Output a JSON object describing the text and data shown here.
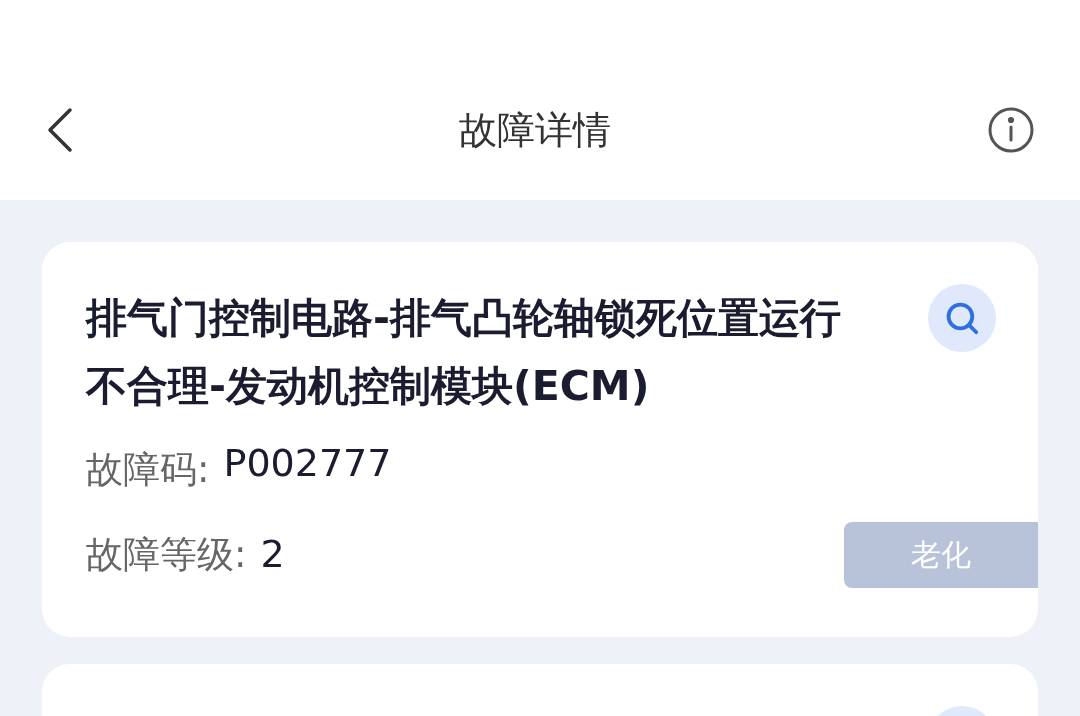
{
  "header": {
    "title": "故障详情"
  },
  "card": {
    "title": "排气门控制电路-排气凸轮轴锁死位置运行不合理-发动机控制模块(ECM)",
    "code_label": "故障码:",
    "code": "P002777",
    "level_label": "故障等级:",
    "level_value": "2",
    "tag": "老化"
  }
}
